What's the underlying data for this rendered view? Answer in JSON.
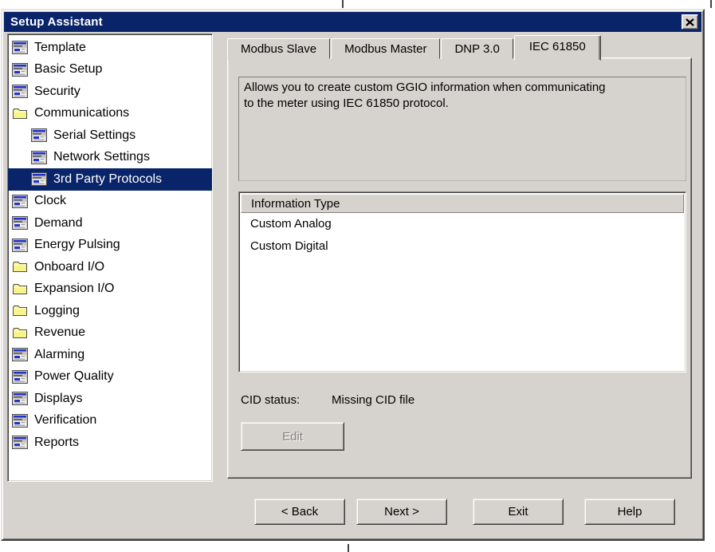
{
  "window": {
    "title": "Setup Assistant"
  },
  "colors": {
    "titlebar": "#0a246a",
    "selection": "#0a246a",
    "dialog_face": "#d6d3ce",
    "list_background": "#ffffff",
    "disabled_text": "#808080"
  },
  "tree": {
    "items": [
      {
        "label": "Template",
        "icon": "sheet",
        "level": 0,
        "selected": false
      },
      {
        "label": "Basic Setup",
        "icon": "sheet",
        "level": 0,
        "selected": false
      },
      {
        "label": "Security",
        "icon": "sheet",
        "level": 0,
        "selected": false
      },
      {
        "label": "Communications",
        "icon": "folder",
        "level": 0,
        "selected": false
      },
      {
        "label": "Serial Settings",
        "icon": "sheet",
        "level": 1,
        "selected": false
      },
      {
        "label": "Network Settings",
        "icon": "sheet",
        "level": 1,
        "selected": false
      },
      {
        "label": "3rd Party Protocols",
        "icon": "sheet",
        "level": 1,
        "selected": true
      },
      {
        "label": "Clock",
        "icon": "sheet",
        "level": 0,
        "selected": false
      },
      {
        "label": "Demand",
        "icon": "sheet",
        "level": 0,
        "selected": false
      },
      {
        "label": "Energy Pulsing",
        "icon": "sheet",
        "level": 0,
        "selected": false
      },
      {
        "label": "Onboard I/O",
        "icon": "folder",
        "level": 0,
        "selected": false
      },
      {
        "label": "Expansion I/O",
        "icon": "folder",
        "level": 0,
        "selected": false
      },
      {
        "label": "Logging",
        "icon": "folder",
        "level": 0,
        "selected": false
      },
      {
        "label": "Revenue",
        "icon": "folder",
        "level": 0,
        "selected": false
      },
      {
        "label": "Alarming",
        "icon": "sheet",
        "level": 0,
        "selected": false
      },
      {
        "label": "Power Quality",
        "icon": "sheet",
        "level": 0,
        "selected": false
      },
      {
        "label": "Displays",
        "icon": "sheet",
        "level": 0,
        "selected": false
      },
      {
        "label": "Verification",
        "icon": "sheet",
        "level": 0,
        "selected": false
      },
      {
        "label": "Reports",
        "icon": "sheet",
        "level": 0,
        "selected": false
      }
    ]
  },
  "tabs": {
    "items": [
      {
        "label": "Modbus Slave",
        "active": false
      },
      {
        "label": "Modbus Master",
        "active": false
      },
      {
        "label": "DNP 3.0",
        "active": false
      },
      {
        "label": "IEC 61850",
        "active": true
      }
    ]
  },
  "panel": {
    "description": "Allows you to create custom GGIO information when communicating\nto the meter using IEC 61850 protocol.",
    "list": {
      "header": "Information Type",
      "rows": [
        "Custom Analog",
        "Custom Digital"
      ]
    },
    "cid_label": "CID status:",
    "cid_value": "Missing CID file",
    "edit_label": "Edit",
    "edit_disabled": true
  },
  "footer": {
    "buttons": [
      {
        "label": "< Back",
        "name": "back-button"
      },
      {
        "label": "Next >",
        "name": "next-button"
      },
      {
        "label": "Exit",
        "name": "exit-button"
      },
      {
        "label": "Help",
        "name": "help-button"
      }
    ]
  }
}
